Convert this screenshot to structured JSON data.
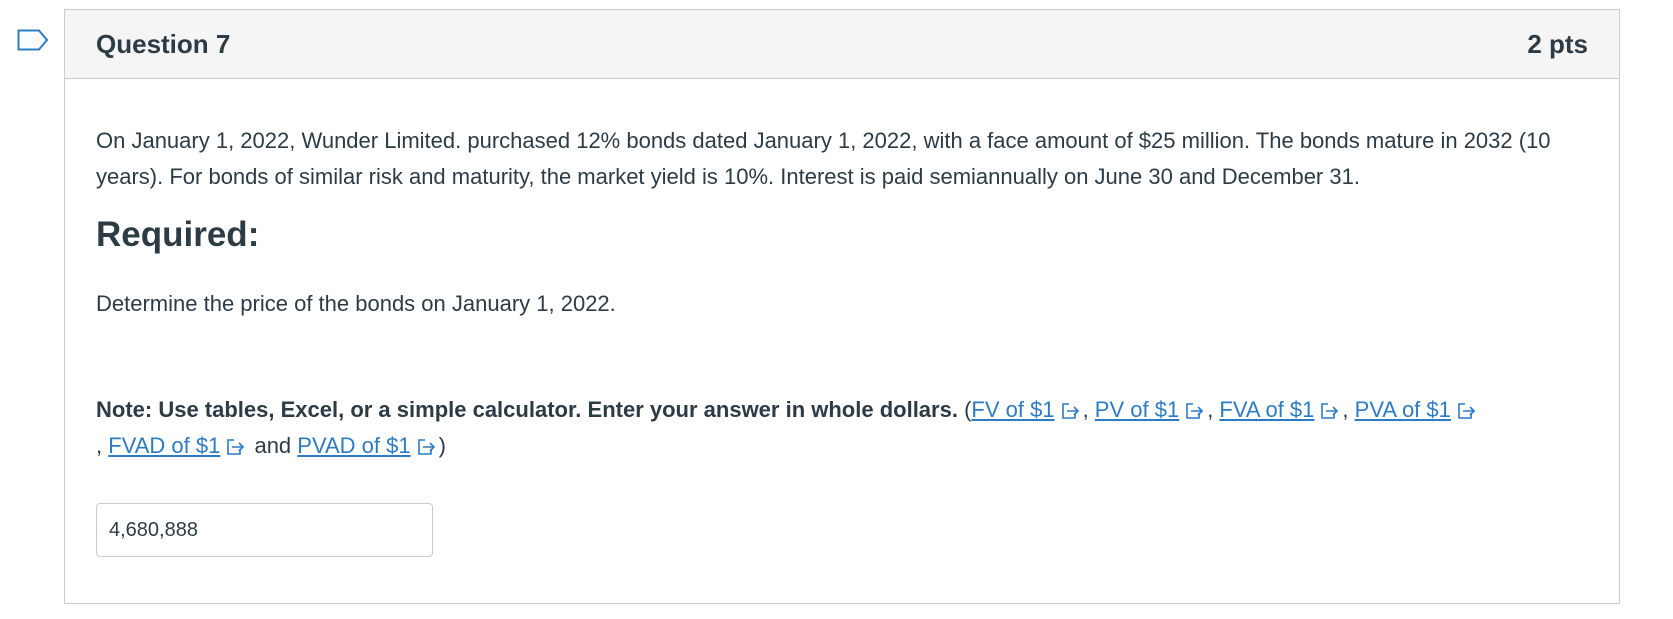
{
  "question": {
    "title": "Question 7",
    "points": "2 pts",
    "paragraph1": "On January 1, 2022, Wunder Limited. purchased 12% bonds dated January 1, 2022, with a face amount of $25 million. The bonds mature in 2032 (10 years). For bonds of similar risk and maturity, the market yield is 10%. Interest is paid semiannually on June 30 and December 31.",
    "required_heading": "Required:",
    "paragraph2": "Determine the price of the bonds on January 1, 2022.",
    "note": {
      "bold_text": "Note: Use tables, Excel, or a simple calculator. Enter your answer in whole dollars.",
      "open_paren": " (",
      "sep_comma": ", ",
      "sep_comma_nospace": ",",
      "and_text": " and ",
      "close_paren": ")",
      "links": {
        "fv": "FV of $1",
        "pv": "PV of $1",
        "fva": "FVA of $1",
        "pva": "PVA of $1",
        "fvad": "FVAD of $1",
        "pvad": "PVAD of $1"
      }
    },
    "answer_value": "4,680,888"
  },
  "icons": {
    "flag": "bookmark-flag-icon",
    "external_link": "external-link-icon"
  },
  "colors": {
    "link": "#2d7bc4",
    "header_bg": "#f5f5f5",
    "border": "#c7cdd1",
    "text": "#2d3b45",
    "flag": "#2d7bc4"
  }
}
